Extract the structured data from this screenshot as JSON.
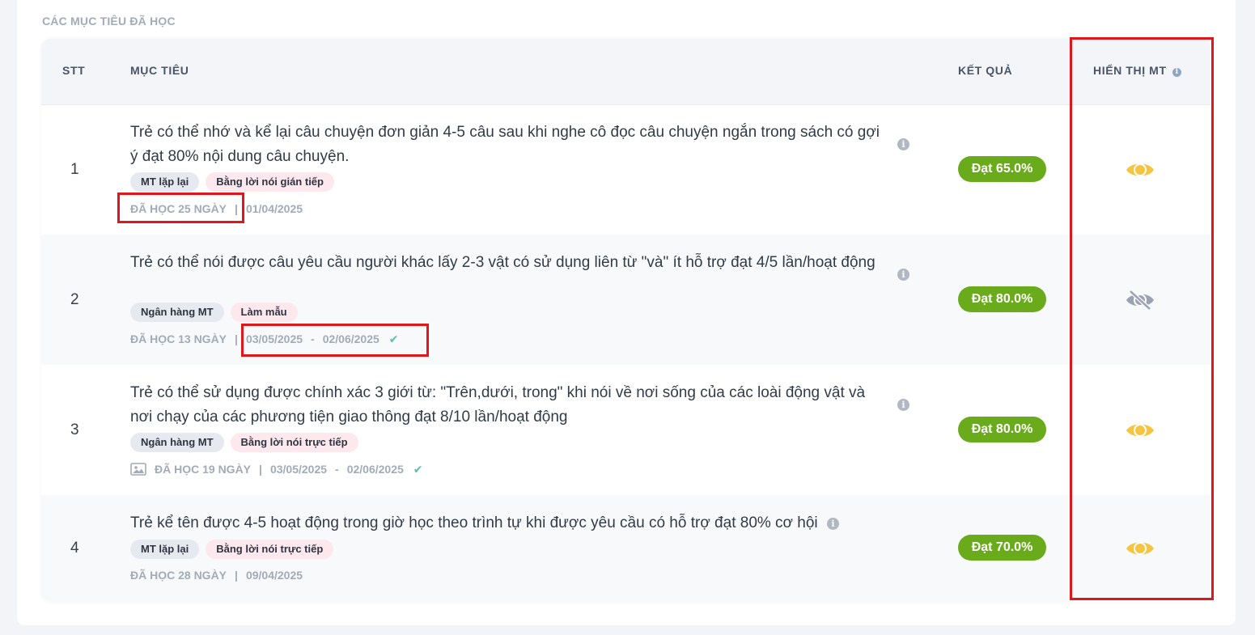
{
  "section_title": "CÁC MỤC TIÊU ĐÃ HỌC",
  "table": {
    "headers": {
      "stt": "STT",
      "goal": "MỤC TIÊU",
      "result": "KẾT QUẢ",
      "display": "HIỂN THỊ MT"
    },
    "rows": [
      {
        "stt": "1",
        "goal": "Trẻ có thể nhớ và kể lại câu chuyện đơn giản 4-5 câu sau khi nghe cô đọc câu chuyện ngắn trong sách có gợi ý đạt 80% nội dung câu chuyện.",
        "tags": [
          "MT lặp lại",
          "Bằng lời nói gián tiếp"
        ],
        "studied": "ĐÃ HỌC 25 NGÀY",
        "date_start": "01/04/2025",
        "result": "Đạt 65.0%",
        "visible": true
      },
      {
        "stt": "2",
        "goal": "Trẻ có thể nói được câu yêu cầu người khác lấy 2-3 vật có sử dụng liên từ \"và\" ít hỗ trợ đạt 4/5 lần/hoạt động",
        "tags": [
          "Ngân hàng MT",
          "Làm mẫu"
        ],
        "studied": "ĐÃ HỌC 13 NGÀY",
        "date_start": "03/05/2025",
        "date_end": "02/06/2025",
        "result": "Đạt 80.0%",
        "visible": false
      },
      {
        "stt": "3",
        "goal": "Trẻ có thể sử dụng được chính xác 3 giới từ: \"Trên,dưới, trong\" khi nói về nơi sống của các loài động vật và nơi chạy của các phương tiện giao thông đạt 8/10 lần/hoạt động",
        "tags": [
          "Ngân hàng MT",
          "Bằng lời nói trực tiếp"
        ],
        "studied": "ĐÃ HỌC 19 NGÀY",
        "date_start": "03/05/2025",
        "date_end": "02/06/2025",
        "result": "Đạt 80.0%",
        "visible": true
      },
      {
        "stt": "4",
        "goal": "Trẻ kể tên được 4-5 hoạt động trong giờ học theo trình tự khi được yêu cầu có hỗ trợ đạt 80% cơ hội",
        "tags": [
          "MT lặp lại",
          "Bằng lời nói trực tiếp"
        ],
        "studied": "ĐÃ HỌC 28 NGÀY",
        "date_start": "09/04/2025",
        "result": "Đạt 70.0%",
        "visible": true
      }
    ]
  },
  "colors": {
    "result_green": "#6aab1c",
    "eye_visible": "#f5c542",
    "eye_hidden": "#9aa3b2",
    "annotation_red": "#e0161b"
  }
}
